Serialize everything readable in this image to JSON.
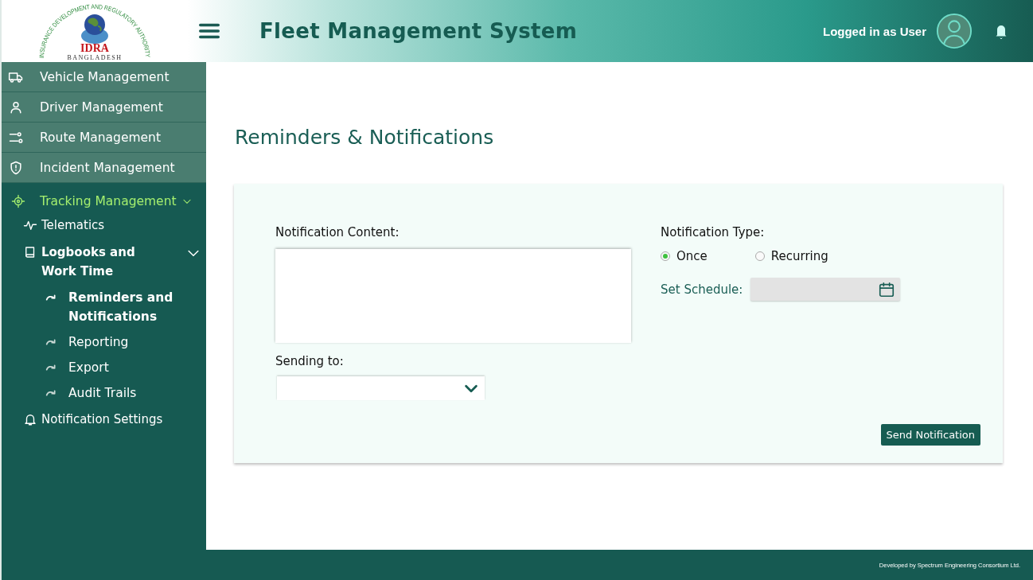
{
  "header": {
    "logo": {
      "arc": "INSURANCE DEVELOPMENT AND REGULATORY AUTHORITY",
      "abbr": "IDRA",
      "country": "BANGLADESH"
    },
    "title": "Fleet Management System",
    "user_label": "Logged in as User"
  },
  "sidebar": {
    "items": [
      {
        "label": "Vehicle Management",
        "kind": "tile"
      },
      {
        "label": "Driver Management",
        "kind": "tile"
      },
      {
        "label": "Route Management",
        "kind": "tile"
      },
      {
        "label": "Incident Management",
        "kind": "tile"
      },
      {
        "label": "Tracking Management",
        "kind": "group",
        "expanded": true,
        "children": [
          {
            "label": "Telematics",
            "kind": "link"
          },
          {
            "label": "Logbooks and Work Time",
            "kind": "link",
            "expanded": true,
            "children": [
              {
                "label": "Reminders and Notifications",
                "selected": true
              },
              {
                "label": "Reporting",
                "selected": false
              },
              {
                "label": "Export",
                "selected": false
              },
              {
                "label": "Audit Trails",
                "selected": false
              }
            ]
          },
          {
            "label": "Notification Settings",
            "kind": "link"
          }
        ]
      }
    ]
  },
  "page": {
    "heading": "Reminders & Notifications",
    "form": {
      "content_label": "Notification Content:",
      "sending_label": "Sending to:",
      "type_label": "Notification Type:",
      "types": [
        {
          "label": "Once",
          "selected": true
        },
        {
          "label": "Recurring",
          "selected": false
        }
      ],
      "schedule_label": "Set Schedule:",
      "submit": "Send Notification"
    }
  },
  "footer": {
    "credit": "Developed by Spectrum Engineering Consortium Ltd."
  }
}
